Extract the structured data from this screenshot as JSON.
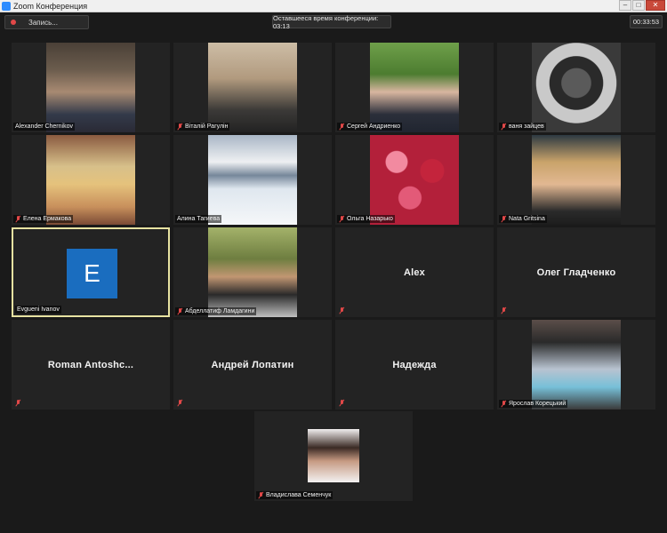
{
  "window": {
    "title": "Zoom Конференция"
  },
  "topbar": {
    "record_label": "Запись...",
    "remaining_time": "Оставшееся время конференции: 03:13",
    "elapsed_time": "00:33:53"
  },
  "participants": [
    {
      "name": "Alexander Chernikov",
      "muted": false,
      "video": true
    },
    {
      "name": "Віталій Рагулін",
      "muted": true,
      "video": true
    },
    {
      "name": "Сергей Андриенко",
      "muted": true,
      "video": true
    },
    {
      "name": "ваня зайцев",
      "muted": true,
      "video": true
    },
    {
      "name": "Елена Ермакова",
      "muted": true,
      "video": true
    },
    {
      "name": "Алина Тагиева",
      "muted": false,
      "video": true
    },
    {
      "name": "Ольга Назарько",
      "muted": true,
      "video": true
    },
    {
      "name": "Nata Gritsina",
      "muted": true,
      "video": true
    },
    {
      "name": "Evgueni Ivanov",
      "muted": false,
      "video": false,
      "avatar_letter": "E",
      "active_speaker": true
    },
    {
      "name": "Абделлатиф Ламдагини",
      "muted": true,
      "video": true
    },
    {
      "name": "Alex",
      "muted": true,
      "video": false
    },
    {
      "name": "Олег Гладченко",
      "muted": true,
      "video": false
    },
    {
      "name": "Roman  Antoshc...",
      "muted": true,
      "video": false
    },
    {
      "name": "Андрей Лопатин",
      "muted": true,
      "video": false
    },
    {
      "name": "Надежда",
      "muted": true,
      "video": false
    },
    {
      "name": "Ярослав Корецький",
      "muted": true,
      "video": true
    },
    {
      "name": "Владислава Семенчук",
      "muted": true,
      "video": true
    }
  ],
  "colors": {
    "active_speaker_border": "#e7e2a1",
    "avatar_bg": "#1a6dbf",
    "mute_icon": "#e24848"
  }
}
